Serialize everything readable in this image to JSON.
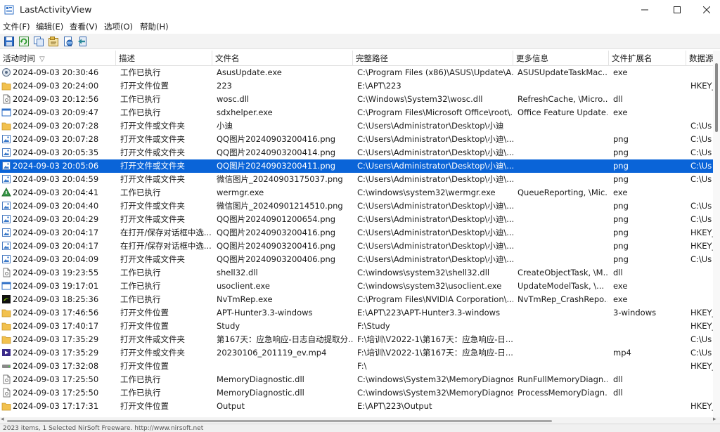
{
  "window": {
    "title": "LastActivityView"
  },
  "menu": [
    "文件(F)",
    "编辑(E)",
    "查看(V)",
    "选项(O)",
    "帮助(H)"
  ],
  "toolbar": [
    "save-icon",
    "refresh-icon",
    "copy-icon",
    "properties-icon",
    "html-report-icon",
    "exit-icon"
  ],
  "columns": [
    "活动时间",
    "描述",
    "文件名",
    "完整路径",
    "更多信息",
    "文件扩展名",
    "数据源"
  ],
  "rows": [
    {
      "icon": "gear-app-icon",
      "time": "2024-09-03 20:30:46",
      "desc": "工作已执行",
      "file": "AsusUpdate.exe",
      "path": "C:\\Program Files (x86)\\ASUS\\Update\\A...",
      "more": "ASUSUpdateTaskMac...",
      "ext": "exe",
      "data": ""
    },
    {
      "icon": "folder-icon",
      "time": "2024-09-03 20:24:00",
      "desc": "打开文件位置",
      "file": "223",
      "path": "E:\\APT\\223",
      "more": "",
      "ext": "",
      "data": "HKEY_"
    },
    {
      "icon": "dll-file-icon",
      "time": "2024-09-03 20:12:56",
      "desc": "工作已执行",
      "file": "wosc.dll",
      "path": "C:\\Windows\\System32\\wosc.dll",
      "more": "RefreshCache, \\Micro...",
      "ext": "dll",
      "data": ""
    },
    {
      "icon": "app-window-icon",
      "time": "2024-09-03 20:09:47",
      "desc": "工作已执行",
      "file": "sdxhelper.exe",
      "path": "C:\\Program Files\\Microsoft Office\\root\\...",
      "more": "Office Feature Update...",
      "ext": "exe",
      "data": ""
    },
    {
      "icon": "folder-icon",
      "time": "2024-09-03 20:07:28",
      "desc": "打开文件或文件夹",
      "file": "小迪",
      "path": "C:\\Users\\Administrator\\Desktop\\小迪",
      "more": "",
      "ext": "",
      "data": "C:\\Us"
    },
    {
      "icon": "image-file-icon",
      "time": "2024-09-03 20:07:28",
      "desc": "打开文件或文件夹",
      "file": "QQ图片20240903200416.png",
      "path": "C:\\Users\\Administrator\\Desktop\\小迪\\...",
      "more": "",
      "ext": "png",
      "data": "C:\\Us"
    },
    {
      "icon": "image-file-icon",
      "time": "2024-09-03 20:05:35",
      "desc": "打开文件或文件夹",
      "file": "QQ图片20240903200414.png",
      "path": "C:\\Users\\Administrator\\Desktop\\小迪\\...",
      "more": "",
      "ext": "png",
      "data": "C:\\Us"
    },
    {
      "icon": "image-file-icon",
      "time": "2024-09-03 20:05:06",
      "desc": "打开文件或文件夹",
      "file": "QQ图片20240903200411.png",
      "path": "C:\\Users\\Administrator\\Desktop\\小迪\\...",
      "more": "",
      "ext": "png",
      "data": "C:\\Us",
      "selected": true
    },
    {
      "icon": "image-file-icon",
      "time": "2024-09-03 20:04:59",
      "desc": "打开文件或文件夹",
      "file": "微信图片_20240903175037.png",
      "path": "C:\\Users\\Administrator\\Desktop\\小迪\\...",
      "more": "",
      "ext": "png",
      "data": "C:\\Us"
    },
    {
      "icon": "wermgr-icon",
      "time": "2024-09-03 20:04:41",
      "desc": "工作已执行",
      "file": "wermgr.exe",
      "path": "C:\\windows\\system32\\wermgr.exe",
      "more": "QueueReporting, \\Mic...",
      "ext": "exe",
      "data": ""
    },
    {
      "icon": "image-file-icon",
      "time": "2024-09-03 20:04:40",
      "desc": "打开文件或文件夹",
      "file": "微信图片_20240901214510.png",
      "path": "C:\\Users\\Administrator\\Desktop\\小迪\\...",
      "more": "",
      "ext": "png",
      "data": "C:\\Us"
    },
    {
      "icon": "image-file-icon",
      "time": "2024-09-03 20:04:29",
      "desc": "打开文件或文件夹",
      "file": "QQ图片20240901200654.png",
      "path": "C:\\Users\\Administrator\\Desktop\\小迪\\...",
      "more": "",
      "ext": "png",
      "data": "C:\\Us"
    },
    {
      "icon": "image-file-icon",
      "time": "2024-09-03 20:04:17",
      "desc": "在打开/保存对话框中选...",
      "file": "QQ图片20240903200416.png",
      "path": "C:\\Users\\Administrator\\Desktop\\小迪\\...",
      "more": "",
      "ext": "png",
      "data": "HKEY_"
    },
    {
      "icon": "image-file-icon",
      "time": "2024-09-03 20:04:17",
      "desc": "在打开/保存对话框中选...",
      "file": "QQ图片20240903200416.png",
      "path": "C:\\Users\\Administrator\\Desktop\\小迪\\...",
      "more": "",
      "ext": "png",
      "data": "HKEY_"
    },
    {
      "icon": "image-file-icon",
      "time": "2024-09-03 20:04:09",
      "desc": "打开文件或文件夹",
      "file": "QQ图片20240903200406.png",
      "path": "C:\\Users\\Administrator\\Desktop\\小迪\\...",
      "more": "",
      "ext": "png",
      "data": "C:\\Us"
    },
    {
      "icon": "dll-file-icon",
      "time": "2024-09-03 19:23:55",
      "desc": "工作已执行",
      "file": "shell32.dll",
      "path": "C:\\windows\\system32\\shell32.dll",
      "more": "CreateObjectTask, \\M...",
      "ext": "dll",
      "data": ""
    },
    {
      "icon": "app-window-icon",
      "time": "2024-09-03 19:17:01",
      "desc": "工作已执行",
      "file": "usoclient.exe",
      "path": "C:\\windows\\system32\\usoclient.exe",
      "more": "UpdateModelTask, \\...",
      "ext": "exe",
      "data": ""
    },
    {
      "icon": "nvidia-icon",
      "time": "2024-09-03 18:25:36",
      "desc": "工作已执行",
      "file": "NvTmRep.exe",
      "path": "C:\\Program Files\\NVIDIA Corporation\\...",
      "more": "NvTmRep_CrashRepo...",
      "ext": "exe",
      "data": ""
    },
    {
      "icon": "folder-icon",
      "time": "2024-09-03 17:46:56",
      "desc": "打开文件位置",
      "file": "APT-Hunter3.3-windows",
      "path": "E:\\APT\\223\\APT-Hunter3.3-windows",
      "more": "",
      "ext": "3-windows",
      "data": "HKEY_"
    },
    {
      "icon": "folder-icon",
      "time": "2024-09-03 17:40:17",
      "desc": "打开文件位置",
      "file": "Study",
      "path": "F:\\Study",
      "more": "",
      "ext": "",
      "data": "HKEY_"
    },
    {
      "icon": "folder-icon",
      "time": "2024-09-03 17:35:29",
      "desc": "打开文件或文件夹",
      "file": "第167天：应急响应-日志自动提取分...",
      "path": "F:\\培训\\V2022-1\\第167天：应急响应-日...",
      "more": "",
      "ext": "",
      "data": "C:\\Us"
    },
    {
      "icon": "video-file-icon",
      "time": "2024-09-03 17:35:29",
      "desc": "打开文件或文件夹",
      "file": "20230106_201119_ev.mp4",
      "path": "F:\\培训\\V2022-1\\第167天：应急响应-日...",
      "more": "",
      "ext": "mp4",
      "data": "C:\\Us"
    },
    {
      "icon": "drive-icon",
      "time": "2024-09-03 17:32:08",
      "desc": "打开文件位置",
      "file": "",
      "path": "F:\\",
      "more": "",
      "ext": "",
      "data": "HKEY_"
    },
    {
      "icon": "dll-file-icon",
      "time": "2024-09-03 17:25:50",
      "desc": "工作已执行",
      "file": "MemoryDiagnostic.dll",
      "path": "C:\\windows\\System32\\MemoryDiagnos...",
      "more": "RunFullMemoryDiagn...",
      "ext": "dll",
      "data": ""
    },
    {
      "icon": "dll-file-icon",
      "time": "2024-09-03 17:25:50",
      "desc": "工作已执行",
      "file": "MemoryDiagnostic.dll",
      "path": "C:\\windows\\System32\\MemoryDiagnos...",
      "more": "ProcessMemoryDiagn...",
      "ext": "dll",
      "data": ""
    },
    {
      "icon": "folder-icon",
      "time": "2024-09-03 17:17:31",
      "desc": "打开文件位置",
      "file": "Output",
      "path": "E:\\APT\\223\\Output",
      "more": "",
      "ext": "",
      "data": "HKEY_"
    }
  ],
  "status": "2023 items, 1 Selected       NirSoft Freeware. http://www.nirsoft.net"
}
